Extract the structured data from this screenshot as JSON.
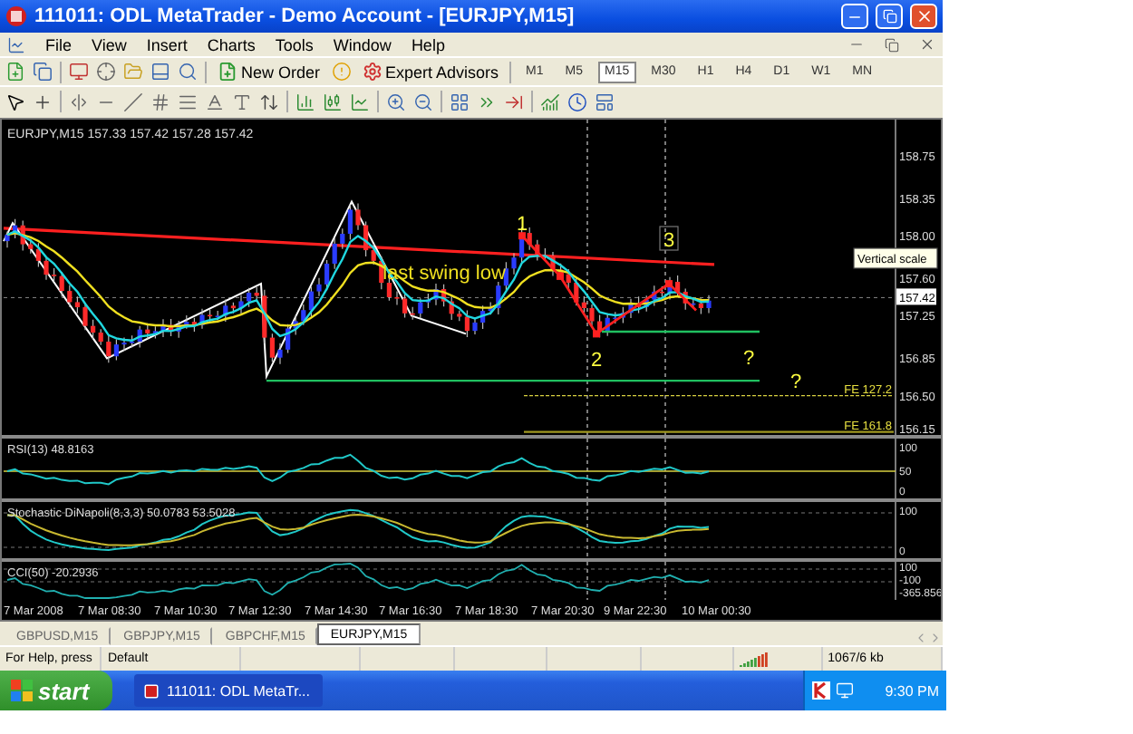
{
  "window": {
    "title": "111011: ODL MetaTrader - Demo Account - [EURJPY,M15]"
  },
  "menu": [
    "File",
    "View",
    "Insert",
    "Charts",
    "Tools",
    "Window",
    "Help"
  ],
  "toolbar": {
    "buttons": [
      "New Order",
      "Expert Advisors"
    ],
    "timeframes": [
      {
        "label": "M1",
        "selected": false
      },
      {
        "label": "M5",
        "selected": false
      },
      {
        "label": "M15",
        "selected": true
      },
      {
        "label": "M30",
        "selected": false
      },
      {
        "label": "H1",
        "selected": false
      },
      {
        "label": "H4",
        "selected": false
      },
      {
        "label": "D1",
        "selected": false
      },
      {
        "label": "W1",
        "selected": false
      },
      {
        "label": "MN",
        "selected": false
      }
    ]
  },
  "chart": {
    "header": "EURJPY,M15  157.33 157.42 157.28 157.42",
    "price_labels": [
      "158.75",
      "158.35",
      "158.00",
      "157.60",
      "157.25",
      "156.85",
      "156.50",
      "156.15"
    ],
    "current_price": "157.42",
    "tooltip": "Vertical scale",
    "annotations": [
      {
        "text": "1",
        "kind": "wave"
      },
      {
        "text": "2",
        "kind": "wave"
      },
      {
        "text": "3",
        "kind": "boxed"
      },
      {
        "text": "?",
        "kind": "wave"
      },
      {
        "text": "?",
        "kind": "wave"
      },
      {
        "text": "last swing low",
        "kind": "caption"
      }
    ],
    "fib_levels": [
      "FE 127.2",
      "FE 161.8"
    ]
  },
  "indicators": [
    {
      "title": "RSI(13) 48.8163",
      "scale": [
        "100",
        "50",
        "0"
      ]
    },
    {
      "title": "Stochastic DiNapoli(8,3,3) 50.0783 53.5028",
      "scale": [
        "100",
        "0"
      ]
    },
    {
      "title": "CCI(50) -20.2936",
      "scale": [
        "100",
        "-100",
        "-365.856"
      ]
    }
  ],
  "time_axis": [
    "7 Mar 2008",
    "7 Mar 08:30",
    "7 Mar 10:30",
    "7 Mar 12:30",
    "7 Mar 14:30",
    "7 Mar 16:30",
    "7 Mar 18:30",
    "7 Mar 20:30",
    "9 Mar 22:30",
    "10 Mar 00:30"
  ],
  "tabs": [
    {
      "label": "GBPUSD,M15",
      "selected": false
    },
    {
      "label": "GBPJPY,M15",
      "selected": false
    },
    {
      "label": "GBPCHF,M15",
      "selected": false
    },
    {
      "label": "EURJPY,M15",
      "selected": true
    }
  ],
  "status_bar": [
    "For Help, press",
    "Default",
    "1067/6 kb"
  ],
  "taskbar": {
    "start": "start",
    "tasks": [
      "111011: ODL MetaTr..."
    ],
    "clock": "9:30 PM"
  }
}
